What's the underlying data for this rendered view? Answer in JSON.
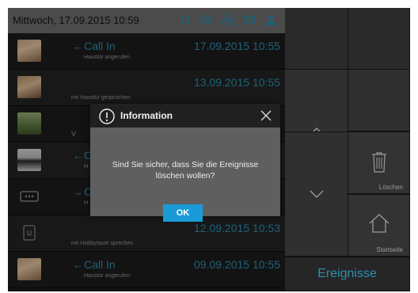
{
  "header": {
    "datetime": "Mittwoch, 17.09.2015 10:59",
    "icons": [
      "doorbell-icon",
      "camera-icon",
      "network-icon",
      "mail-icon",
      "person-icon",
      "phone-icon"
    ]
  },
  "events": [
    {
      "kind": "call",
      "direction": "←",
      "title": "Call In",
      "subtitle": "Haustür angerufen",
      "time": "17.09.2015 10:55",
      "thumb": "face1"
    },
    {
      "kind": "voice",
      "direction": "",
      "title": "",
      "subtitle": "mit Haustür gesprochen",
      "time": "13.09.2015 10:55",
      "thumb": "face2"
    },
    {
      "kind": "visit",
      "direction": "",
      "title": "",
      "subtitle": "V",
      "time": "",
      "thumb": "garden"
    },
    {
      "kind": "call",
      "direction": "←",
      "title": "C",
      "subtitle": "H",
      "time": "5",
      "thumb": "woman"
    },
    {
      "kind": "message",
      "direction": "→",
      "title": "C",
      "subtitle": "H",
      "time": "5",
      "thumb": "intercom-icon"
    },
    {
      "kind": "voice",
      "direction": "",
      "title": "",
      "subtitle": "mit Hobbyraum sprechen",
      "time": "12.09.2015 10:53",
      "thumb": "room-station-icon"
    },
    {
      "kind": "call",
      "direction": "←",
      "title": "Call In",
      "subtitle": "Haustür angerufen",
      "time": "09.09.2015 10:55",
      "thumb": "face1"
    }
  ],
  "panel": {
    "delete_label": "Löschen",
    "home_label": "Startseite",
    "tab_label": "Ereignisse"
  },
  "dialog": {
    "title": "Information",
    "message_line1": "Sind Sie sicher, dass Sie die Ereignisse",
    "message_line2": "löschen wollen?",
    "ok_label": "OK"
  },
  "colors": {
    "accent": "#2f8fb0",
    "ok_button": "#1a9ad7",
    "header_bg": "#6f6f6f"
  }
}
